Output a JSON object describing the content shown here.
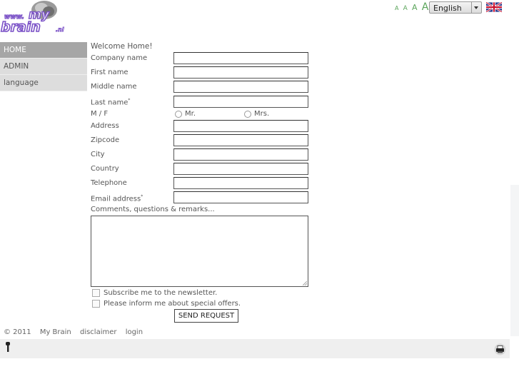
{
  "header": {
    "logo_alt": "www.mybrain.nl",
    "logo_line1": "www.",
    "logo_my": "my",
    "logo_brain": "brain",
    "logo_tld": ".nl",
    "font_size_options": [
      "A",
      "A",
      "A",
      "A"
    ],
    "language_select": {
      "selected": "English"
    },
    "flag_icon": "uk-flag-icon"
  },
  "sidebar": {
    "items": [
      {
        "label": "HOME",
        "active": true
      },
      {
        "label": "ADMIN",
        "active": false
      },
      {
        "label": "language",
        "active": false
      }
    ]
  },
  "form": {
    "welcome": "Welcome Home!",
    "fields": [
      {
        "label": "Company name",
        "required": false,
        "value": ""
      },
      {
        "label": "First name",
        "required": false,
        "value": ""
      },
      {
        "label": "Middle name",
        "required": false,
        "value": ""
      },
      {
        "label": "Last name",
        "required": true,
        "value": ""
      }
    ],
    "gender": {
      "label": "M / F",
      "options": [
        "Mr.",
        "Mrs."
      ],
      "selected": null
    },
    "fields2": [
      {
        "label": "Address",
        "required": false,
        "value": ""
      },
      {
        "label": "Zipcode",
        "required": false,
        "value": ""
      },
      {
        "label": "City",
        "required": false,
        "value": ""
      },
      {
        "label": "Country",
        "required": false,
        "value": ""
      },
      {
        "label": "Telephone",
        "required": false,
        "value": ""
      },
      {
        "label": "Email address",
        "required": true,
        "value": ""
      }
    ],
    "required_marker": "*",
    "comments_label": "Comments, questions & remarks...",
    "comments_value": "",
    "checkboxes": [
      {
        "label": "Subscribe me to the newsletter.",
        "checked": false
      },
      {
        "label": "Please inform me about special offers.",
        "checked": false
      }
    ],
    "submit_label": "SEND REQUEST"
  },
  "footer": {
    "copyright": "© 2011",
    "links": [
      "My Brain",
      "disclaimer",
      "login"
    ]
  },
  "colors": {
    "accent_green": "#5ba55b",
    "nav_active": "#a6a6a6",
    "nav_bg": "#dddddd",
    "logo_purple": "#7b52c7"
  }
}
